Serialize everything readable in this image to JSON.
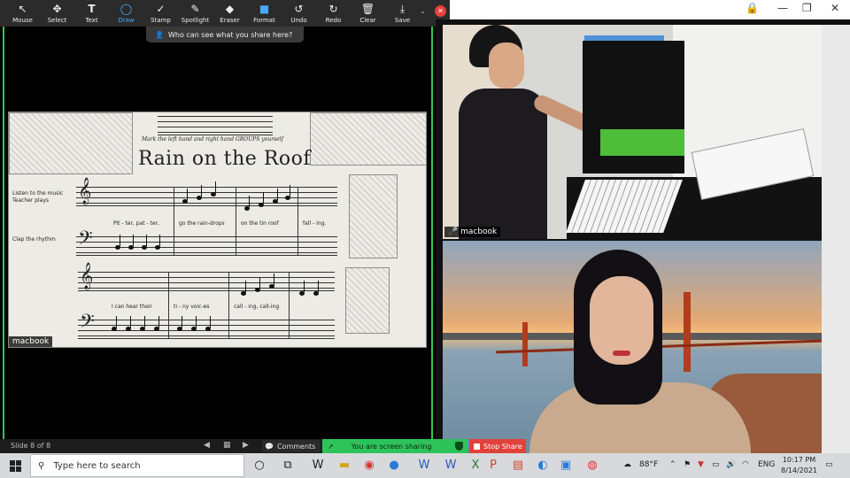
{
  "toolbar": {
    "tools": [
      {
        "label": "Mouse",
        "icon": "mouse-pointer-icon",
        "glyph": "↖"
      },
      {
        "label": "Select",
        "icon": "move-icon",
        "glyph": "✥"
      },
      {
        "label": "Text",
        "icon": "text-icon",
        "glyph": "T"
      },
      {
        "label": "Draw",
        "icon": "draw-icon",
        "glyph": "◯",
        "active": true
      },
      {
        "label": "Stamp",
        "icon": "stamp-icon",
        "glyph": "✓"
      },
      {
        "label": "Spotlight",
        "icon": "spotlight-icon",
        "glyph": "✎"
      },
      {
        "label": "Eraser",
        "icon": "eraser-icon",
        "glyph": "◆"
      },
      {
        "label": "Format",
        "icon": "format-icon",
        "glyph": "■"
      },
      {
        "label": "Undo",
        "icon": "undo-icon",
        "glyph": "↺"
      },
      {
        "label": "Redo",
        "icon": "redo-icon",
        "glyph": "↻"
      },
      {
        "label": "Clear",
        "icon": "trash-icon",
        "glyph": "🗑"
      },
      {
        "label": "Save",
        "icon": "save-icon",
        "glyph": "⤓"
      }
    ],
    "accent": "#4aa8ff"
  },
  "share_banner": {
    "who_label": "Who can see what you share here?"
  },
  "sheet_music": {
    "instruction": "Mark the left hand and right hand GROUPS yourself",
    "title": "Rain on the Roof",
    "lyrics_row1": [
      "Pit - ter, pat - ter,",
      "go  the  rain-drops",
      "on  the  tin  roof",
      "fall - ing."
    ],
    "lyrics_row2": [
      "I  can hear their",
      "ti - ny voic-es",
      "call - ing, call-ing",
      ""
    ],
    "side_note_1": "Listen to the music Teacher plays",
    "side_note_2": "Clap the rhythm"
  },
  "participants": [
    {
      "name": "macbook"
    },
    {
      "name": "macbook"
    }
  ],
  "meeting_controls": {
    "slide_label": "Slide 8 of 8",
    "comments_label": "Comments",
    "sharing_label": "You are screen sharing",
    "stop_share_label": "Stop Share",
    "sharing_color": "#2ec35a",
    "stop_color": "#e0413a"
  },
  "taskbar": {
    "search_placeholder": "Type here to search",
    "weather": "88°F",
    "language": "ENG",
    "time": "10:17 PM",
    "date": "8/14/2021"
  }
}
